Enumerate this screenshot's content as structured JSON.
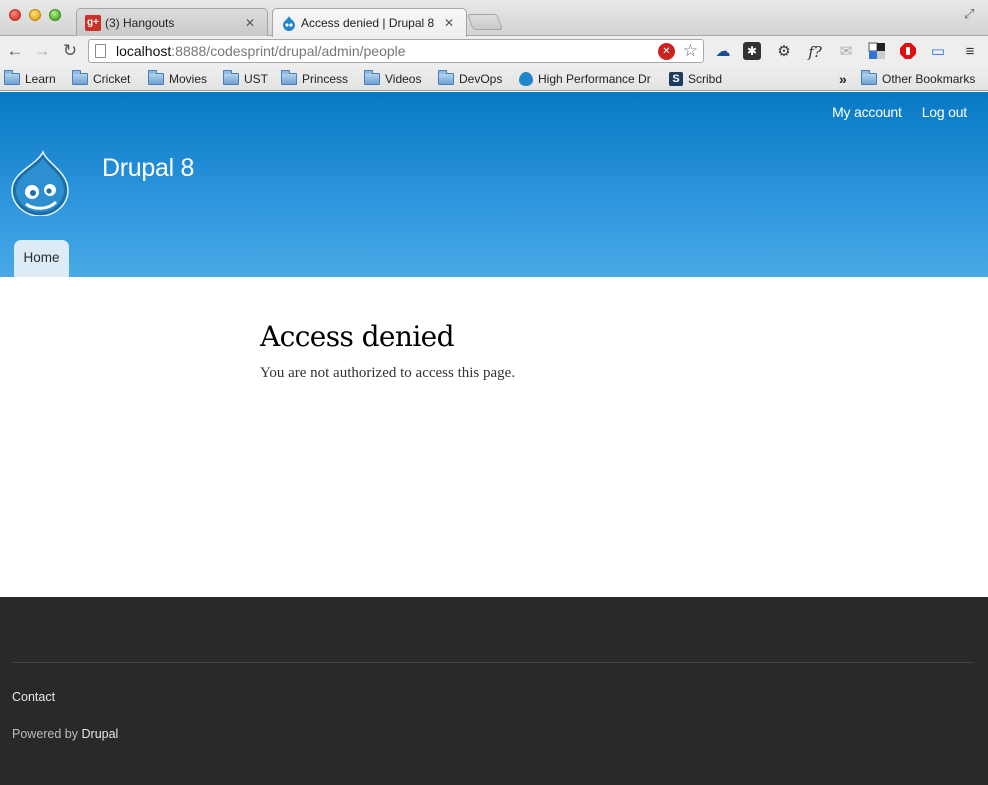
{
  "browser": {
    "tabs": [
      {
        "title": "(3) Hangouts",
        "icon": "google-plus-icon",
        "active": false
      },
      {
        "title": "Access denied | Drupal 8",
        "icon": "drupal-icon",
        "active": true
      }
    ],
    "address_bar": {
      "host": "localhost",
      "path": ":8888/codesprint/drupal/admin/people"
    },
    "bookmarks": [
      {
        "label": "Learn",
        "icon": "folder-icon"
      },
      {
        "label": "Cricket",
        "icon": "folder-icon"
      },
      {
        "label": "Movies",
        "icon": "folder-icon"
      },
      {
        "label": "UST",
        "icon": "folder-icon"
      },
      {
        "label": "Princess",
        "icon": "folder-icon"
      },
      {
        "label": "Videos",
        "icon": "folder-icon"
      },
      {
        "label": "DevOps",
        "icon": "folder-icon"
      },
      {
        "label": "High Performance Dr",
        "icon": "drupal-icon"
      },
      {
        "label": "Scribd",
        "icon": "scribd-icon"
      }
    ],
    "overflow_label": "»",
    "other_bookmarks": "Other Bookmarks"
  },
  "site": {
    "name": "Drupal 8",
    "secondary_menu": [
      "My account",
      "Log out"
    ],
    "main_menu": [
      "Home"
    ],
    "colors": {
      "header_top": "#0779c4",
      "header_bottom": "#48a9e4",
      "footer": "#292929"
    }
  },
  "main": {
    "title": "Access denied",
    "message": "You are not authorized to access this page."
  },
  "footer": {
    "contact": "Contact",
    "powered_prefix": "Powered by",
    "powered_link": "Drupal"
  }
}
